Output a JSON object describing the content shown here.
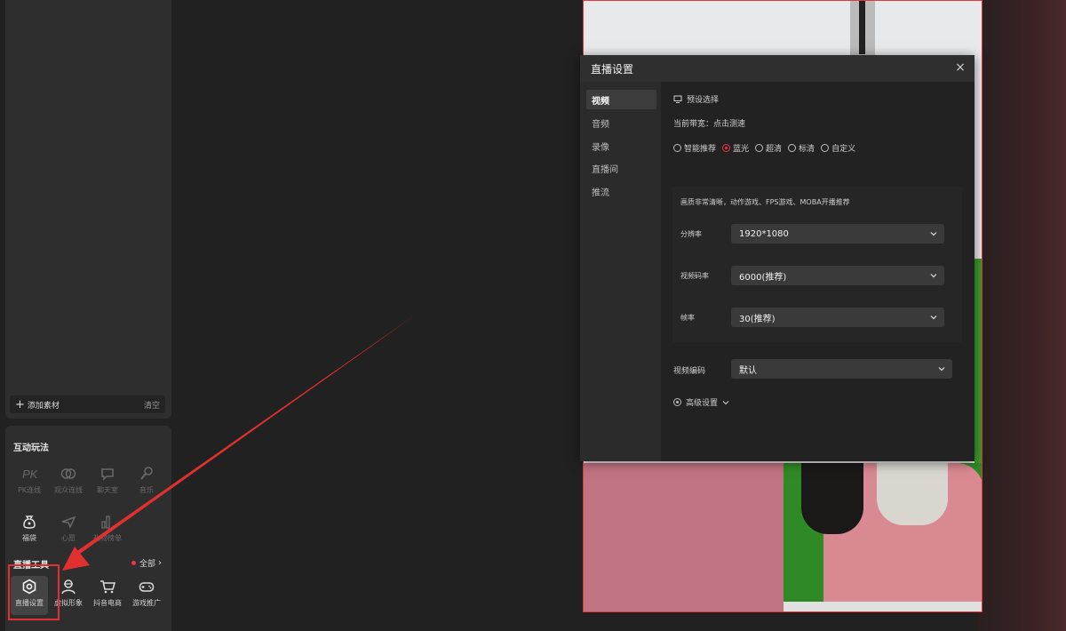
{
  "left_panel": {
    "add_material": "添加素材",
    "clear": "清空"
  },
  "interactive": {
    "title": "互动玩法",
    "items": [
      {
        "label": "PK连线",
        "icon": "pk-icon"
      },
      {
        "label": "观众连线",
        "icon": "link-icon"
      },
      {
        "label": "聊天室",
        "icon": "chat-icon"
      },
      {
        "label": "音乐",
        "icon": "microphone-icon"
      },
      {
        "label": "福袋",
        "icon": "lucky-bag-icon"
      },
      {
        "label": "心愿",
        "icon": "wish-icon"
      },
      {
        "label": "礼物榜单",
        "icon": "chart-icon"
      }
    ]
  },
  "tools": {
    "title": "直播工具",
    "all_label": "全部",
    "items": [
      {
        "label": "直播设置",
        "icon": "settings-icon"
      },
      {
        "label": "虚拟形象",
        "icon": "avatar-icon"
      },
      {
        "label": "抖音电商",
        "icon": "cart-icon"
      },
      {
        "label": "游戏推广",
        "icon": "gamepad-icon"
      }
    ]
  },
  "dialog": {
    "title": "直播设置",
    "close": "×",
    "tabs": [
      "视频",
      "音频",
      "录像",
      "直播间",
      "推流"
    ],
    "active_tab": "视频",
    "preset_label": "预设选择",
    "bandwidth_text": "当前带宽：点击测速",
    "presets": [
      "智能推荐",
      "蓝光",
      "超清",
      "标清",
      "自定义"
    ],
    "selected_preset": "蓝光",
    "quality_desc": "画质非常清晰，动作游戏、FPS游戏、MOBA开播推荐",
    "resolution_label": "分辨率",
    "resolution_value": "1920*1080",
    "bitrate_label": "视频码率",
    "bitrate_value": "6000(推荐)",
    "framerate_label": "帧率",
    "framerate_value": "30(推荐)",
    "encoder_label": "视频编码",
    "encoder_value": "默认",
    "advanced_label": "高级设置"
  },
  "colors": {
    "accent": "#f0314f",
    "highlight": "#e0302f",
    "background": "#212121"
  }
}
